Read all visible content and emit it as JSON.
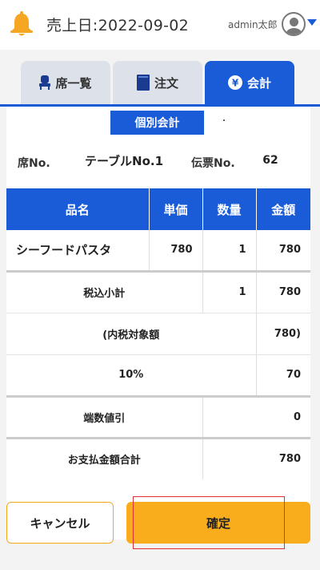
{
  "header": {
    "sales_date": "売上日:2022-09-02",
    "user_name": "admin太郎",
    "icons": {
      "notification": "bell-icon",
      "user": "avatar-icon",
      "menu": "chevron-down-icon"
    }
  },
  "tabs": [
    {
      "label": "席一覧",
      "icon": "chair-icon",
      "active": false
    },
    {
      "label": "注文",
      "icon": "menu-book-icon",
      "active": false
    },
    {
      "label": "会計",
      "icon": "yen-icon",
      "active": true
    }
  ],
  "split_bill_label": "個別会計",
  "info": {
    "seat_label": "席No.",
    "seat_value": "テーブルNo.1",
    "slip_label": "伝票No.",
    "slip_value": "62"
  },
  "table": {
    "headers": [
      "品名",
      "単価",
      "数量",
      "金額"
    ],
    "items": [
      {
        "name": "シーフードパスタ",
        "unit_price": "780",
        "qty": "1",
        "amount": "780"
      }
    ],
    "subtotal": {
      "label": "税込小計",
      "qty": "1",
      "amount": "780"
    },
    "tax_base": {
      "label": "(内税対象額",
      "amount": "780)"
    },
    "tax_rate": {
      "label": "10%",
      "amount": "70"
    },
    "rounding": {
      "label": "端数値引",
      "amount": "0"
    },
    "total": {
      "label": "お支払金額合計",
      "amount": "780"
    }
  },
  "buttons": {
    "cancel": "キャンセル",
    "confirm": "確定"
  },
  "colors": {
    "primary": "#1a5bd8",
    "accent": "#f9ad1c",
    "bell": "#f5a623"
  }
}
